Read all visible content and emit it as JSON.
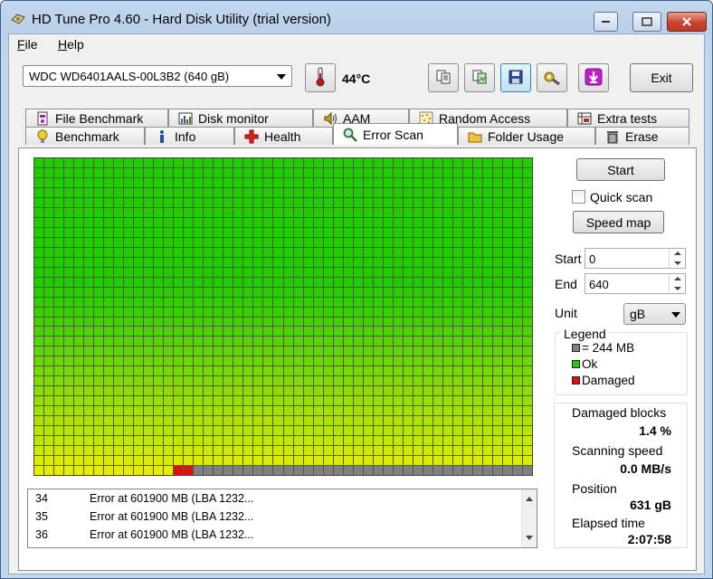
{
  "window": {
    "title": "HD Tune Pro 4.60 - Hard Disk Utility (trial version)"
  },
  "menu": {
    "file": "File",
    "help": "Help"
  },
  "toolbar": {
    "drive": "WDC WD6401AALS-00L3B2 (640 gB)",
    "temperature": "44°C",
    "exit_label": "Exit"
  },
  "tabs_top": [
    {
      "label": "File Benchmark",
      "icon": "file-benchmark-icon"
    },
    {
      "label": "Disk monitor",
      "icon": "disk-monitor-icon"
    },
    {
      "label": "AAM",
      "icon": "speaker-icon"
    },
    {
      "label": "Random Access",
      "icon": "random-access-icon"
    },
    {
      "label": "Extra tests",
      "icon": "extra-tests-icon"
    }
  ],
  "tabs_bottom": [
    {
      "label": "Benchmark",
      "icon": "benchmark-icon"
    },
    {
      "label": "Info",
      "icon": "info-icon"
    },
    {
      "label": "Health",
      "icon": "health-cross-icon"
    },
    {
      "label": "Error Scan",
      "icon": "magnifier-icon",
      "active": true
    },
    {
      "label": "Folder Usage",
      "icon": "folder-icon"
    },
    {
      "label": "Erase",
      "icon": "trash-icon"
    }
  ],
  "scan_grid": {
    "columns": 50,
    "rows": 32,
    "colors": {
      "ok_top": "#22cc00",
      "ok_bottom": "#e6ee00",
      "unscanned": "#808080",
      "damaged": "#dd1111"
    },
    "last_row": {
      "damaged_cells": [
        14,
        15
      ],
      "unscanned_from": 16
    }
  },
  "controls": {
    "start_label": "Start",
    "quick_scan_label": "Quick scan",
    "speed_map_label": "Speed map",
    "start_field_label": "Start",
    "start_value": "0",
    "end_field_label": "End",
    "end_value": "640",
    "unit_label": "Unit",
    "unit_value": "gB"
  },
  "legend": {
    "title": "Legend",
    "items": [
      {
        "label": "= 244 MB",
        "color": "#808080"
      },
      {
        "label": "Ok",
        "color": "#22cc00"
      },
      {
        "label": "Damaged",
        "color": "#dd1111"
      }
    ]
  },
  "stats": {
    "damaged_label": "Damaged blocks",
    "damaged_value": "1.4 %",
    "speed_label": "Scanning speed",
    "speed_value": "0.0 MB/s",
    "position_label": "Position",
    "position_value": "631 gB",
    "elapsed_label": "Elapsed time",
    "elapsed_value": "2:07:58"
  },
  "log": [
    {
      "num": "34",
      "msg": "Error at 601900 MB (LBA 1232..."
    },
    {
      "num": "35",
      "msg": "Error at 601900 MB (LBA 1232..."
    },
    {
      "num": "36",
      "msg": "Error at 601900 MB (LBA 1232..."
    }
  ]
}
